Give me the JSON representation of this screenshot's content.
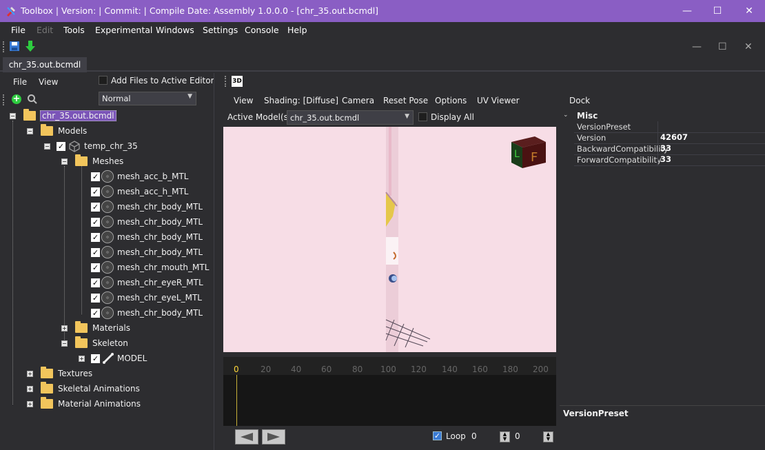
{
  "window": {
    "title": "Toolbox | Version:  | Commit:  | Compile Date:  Assembly 1.0.0.0 - [chr_35.out.bcmdl]",
    "minimize": "—",
    "maximize": "☐",
    "close": "✕"
  },
  "menubar": [
    "File",
    "Edit",
    "Tools",
    "Experimental",
    "Windows",
    "Settings",
    "Console",
    "Help"
  ],
  "doc_tab": "chr_35.out.bcmdl",
  "left": {
    "menu": [
      "File",
      "View"
    ],
    "add_files_label": "Add Files to Active Editor",
    "mode_select": "Normal",
    "tree": {
      "root": "chr_35.out.bcmdl",
      "models": "Models",
      "model_name": "temp_chr_35",
      "meshes": "Meshes",
      "mesh_items": [
        "mesh_acc_b_MTL",
        "mesh_acc_h_MTL",
        "mesh_chr_body_MTL",
        "mesh_chr_body_MTL",
        "mesh_chr_body_MTL",
        "mesh_chr_body_MTL",
        "mesh_chr_mouth_MTL",
        "mesh_chr_eyeR_MTL",
        "mesh_chr_eyeL_MTL",
        "mesh_chr_body_MTL"
      ],
      "materials": "Materials",
      "skeleton": "Skeleton",
      "bone": "MODEL",
      "textures": "Textures",
      "skeletal_animations": "Skeletal Animations",
      "material_animations": "Material Animations"
    }
  },
  "viewer": {
    "tab_label": "3D",
    "menu": [
      "View",
      "Shading: [Diffuse]",
      "Camera",
      "Reset Pose",
      "Options",
      "UV Viewer"
    ],
    "active_models_label": "Active Model(s):",
    "active_model": "chr_35.out.bcmdl",
    "display_all": "Display All",
    "ruler": [
      "0",
      "20",
      "40",
      "60",
      "80",
      "100",
      "120",
      "140",
      "160",
      "180",
      "200"
    ],
    "loop_label": "Loop",
    "frame_value": "0",
    "end_value": "0"
  },
  "props": {
    "dock_label": "Dock",
    "category": "Misc",
    "rows": [
      {
        "name": "VersionPreset",
        "value": ""
      },
      {
        "name": "Version",
        "value": "42607"
      },
      {
        "name": "BackwardCompatibility",
        "value": "33"
      },
      {
        "name": "ForwardCompatibility",
        "value": "33"
      }
    ],
    "description_title": "VersionPreset"
  },
  "colors": {
    "titlebar": "#8a5ec4",
    "viewport_bg": "#f7dde6",
    "accent": "#8a5ec4"
  }
}
